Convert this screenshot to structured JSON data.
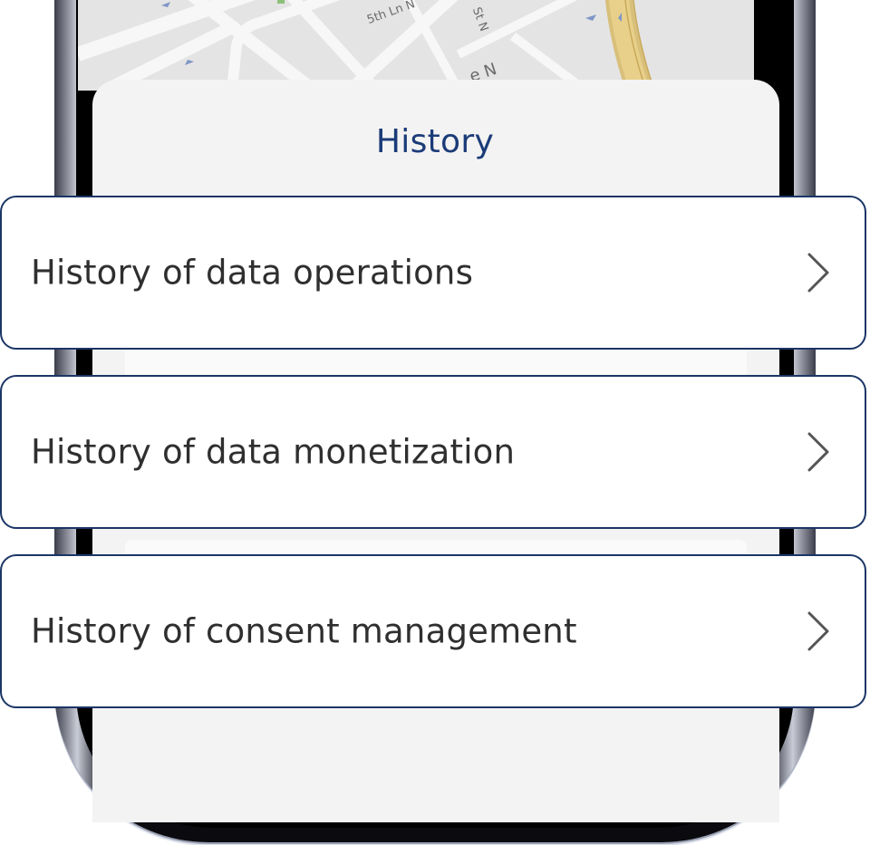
{
  "map": {
    "street_labels": [
      "5th Ln N",
      "St N",
      "e N"
    ]
  },
  "sheet": {
    "title": "History"
  },
  "options": [
    {
      "label": "History of data operations",
      "icon": "chevron-right-icon"
    },
    {
      "label": "History of data monetization",
      "icon": "chevron-right-icon"
    },
    {
      "label": "History of consent management",
      "icon": "chevron-right-icon"
    }
  ],
  "colors": {
    "title": "#1b3b78",
    "card_border": "#1b3666",
    "text": "#2f2f2f",
    "chevron": "#555555",
    "sheet_bg": "#f3f3f3"
  }
}
